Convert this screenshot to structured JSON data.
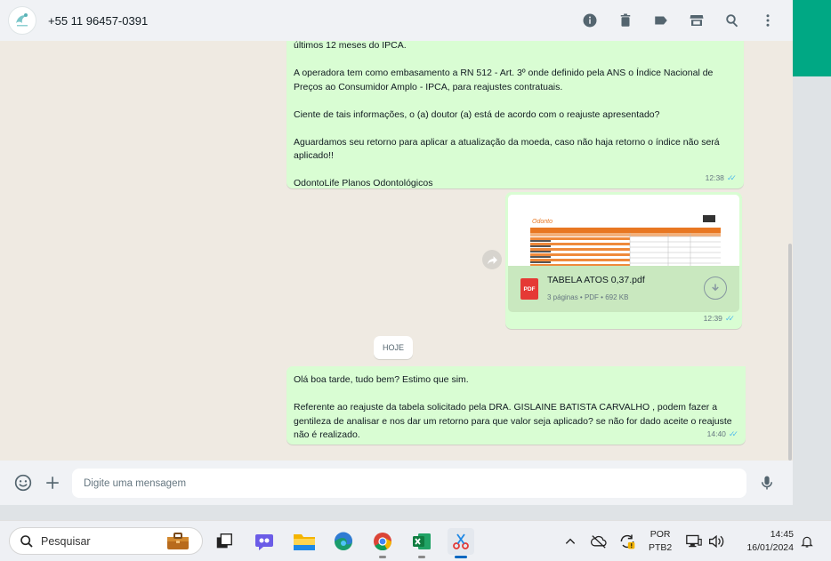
{
  "header": {
    "contact": "+55 11 96457-0391"
  },
  "messages": {
    "m1": {
      "text": "últimos 12 meses do IPCA.\n\nA operadora tem como embasamento a RN 512 - Art. 3º onde definido pela ANS o Índice Nacional de Preços ao Consumidor Amplo - IPCA, para reajustes contratuais.\n\nCiente de tais informações, o (a) doutor (a) está de acordo com o reajuste apresentado?\n\nAguardamos seu retorno para aplicar a atualização da moeda, caso não haja retorno o índice não será aplicado!!\n\nOdontoLife Planos Odontológicos",
      "time": "12:38"
    },
    "m2": {
      "file_name": "TABELA ATOS 0,37.pdf",
      "file_meta": "3 páginas • PDF • 692 KB",
      "file_type": "PDF",
      "time": "12:39"
    },
    "day_divider": "HOJE",
    "m3": {
      "text": "Olá boa tarde, tudo bem? Estimo que sim.\n\nReferente ao reajuste da tabela solicitado pela DRA. GISLAINE BATISTA CARVALHO , podem fazer a gentileza de analisar e nos dar um retorno para que valor seja aplicado? se não for dado aceite o reajuste não é realizado.",
      "time": "14:40"
    }
  },
  "composer": {
    "placeholder": "Digite uma mensagem"
  },
  "taskbar": {
    "search_label": "Pesquisar",
    "lang_top": "POR",
    "lang_bottom": "PTB2",
    "time": "14:45",
    "date": "16/01/2024"
  },
  "colors": {
    "accent": "#00a884",
    "bubble_out": "#d9fdd3",
    "bg": "#efeae2"
  }
}
